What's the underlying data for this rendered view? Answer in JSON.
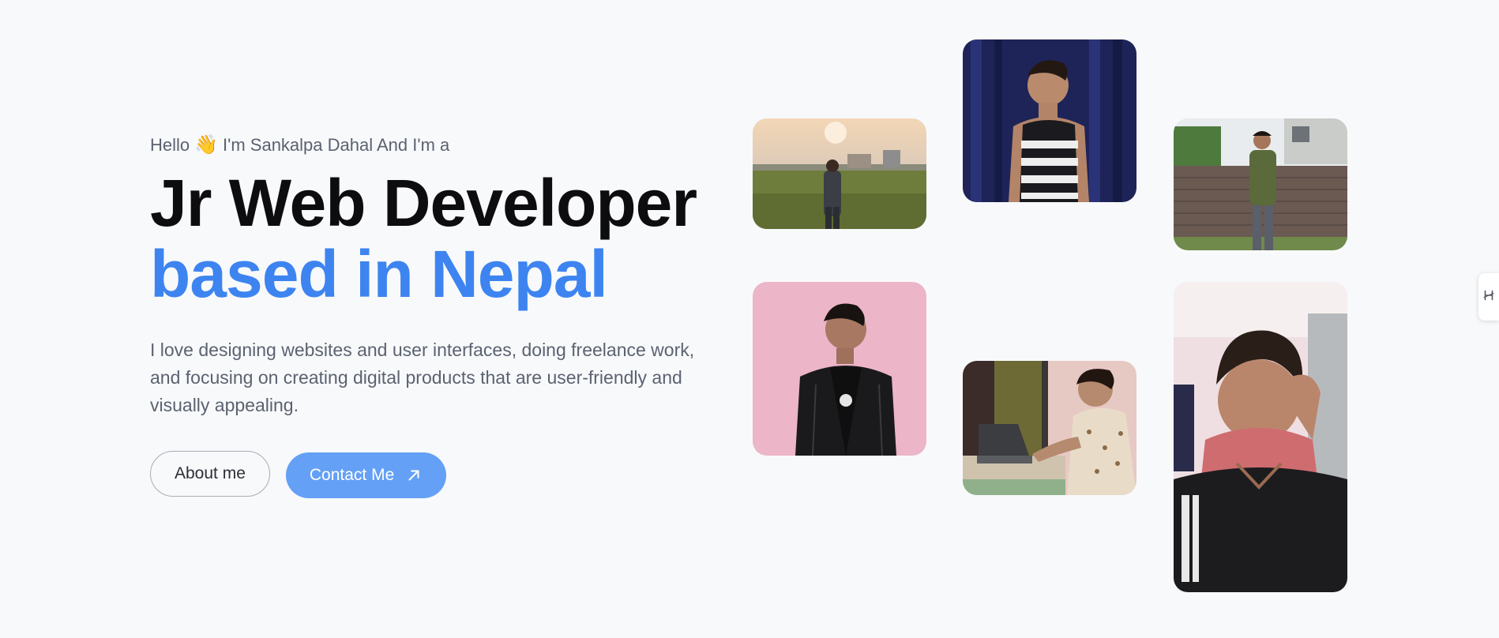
{
  "hero": {
    "greeting_prefix": "Hello",
    "greeting_emoji": "👋",
    "greeting_suffix": "I'm Sankalpa Dahal And I'm a",
    "headline_line1": "Jr Web Developer",
    "headline_line2": "based in Nepal",
    "description": "I love designing websites and user interfaces, doing freelance work, and focusing on creating digital products that are user-friendly and visually appealing.",
    "about_button": "About me",
    "contact_button": "Contact Me",
    "contact_icon": "arrow-up-right-icon"
  },
  "colors": {
    "background": "#f8f9fb",
    "heading": "#0d0d0f",
    "accent": "#3d84f0",
    "button_contact": "#64a0f5",
    "body_text": "#5b6270"
  },
  "gallery": {
    "photos": [
      {
        "name": "photo-field",
        "alt": "Person standing in a grass field at sunset"
      },
      {
        "name": "photo-curtain",
        "alt": "Person in striped tank top in front of blue curtain"
      },
      {
        "name": "photo-wall",
        "alt": "Person in green shirt standing by a brick wall"
      },
      {
        "name": "photo-pink-wall",
        "alt": "Person in black jacket against pink wall"
      },
      {
        "name": "photo-laptop",
        "alt": "Person working on a laptop"
      },
      {
        "name": "photo-selfie",
        "alt": "Selfie of person in hoodie"
      }
    ]
  },
  "side_tab": {
    "icon": "hashnode-icon"
  }
}
